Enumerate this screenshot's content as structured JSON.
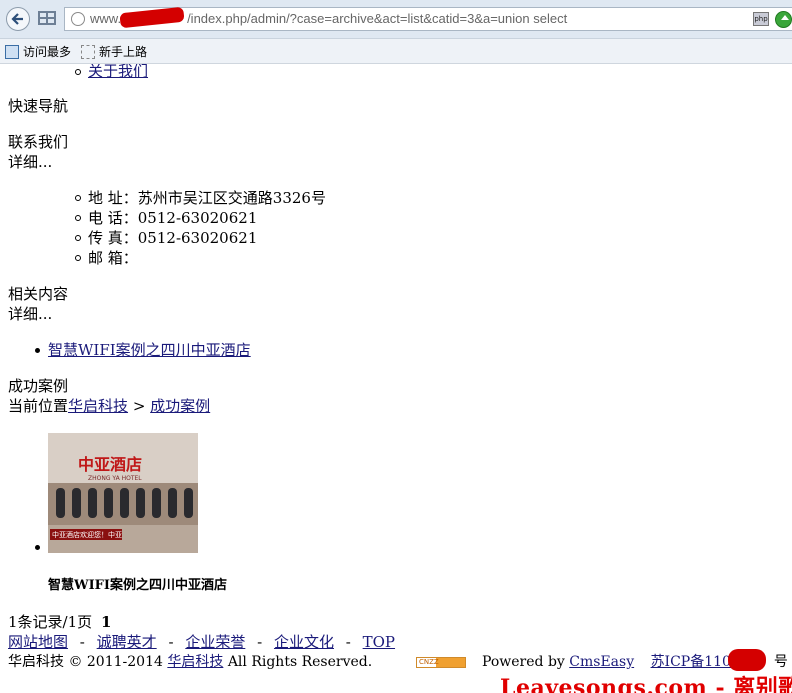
{
  "browser": {
    "url": "www.██████/index.php/admin/?case=archive&act=list&catid=3&a=union select",
    "url_visible_prefix": "www.",
    "url_visible_rest": "/index.php/admin/?case=archive&act=list&catid=3&a=union select",
    "php_badge": "php",
    "bookmarks": [
      "访问最多",
      "新手上路"
    ]
  },
  "page": {
    "top_item": "关于我们",
    "quick_nav": "快速导航",
    "contact": {
      "title": "联系我们",
      "more": "详细...",
      "items": [
        "地 址：苏州市吴江区交通路3326号",
        "电 话：0512-63020621",
        "传 真：0512-63020621",
        "邮 箱："
      ]
    },
    "related": {
      "title": "相关内容",
      "more": "详细...",
      "items": [
        "智慧WIFI案例之四川中亚酒店"
      ]
    },
    "cases": {
      "title": "成功案例",
      "breadcrumb_prefix": "当前位置",
      "breadcrumb_home": "华启科技",
      "breadcrumb_sep": ">",
      "breadcrumb_current": "成功案例",
      "thumb_sign": "中亚酒店",
      "thumb_sub": "ZHONG YA HOTEL",
      "thumb_banner": "中亚酒店欢迎您！中亚",
      "caption": "智慧WIFI案例之四川中亚酒店"
    },
    "pager": {
      "text": "1条记录/1页",
      "current": "1"
    },
    "footer": {
      "links": [
        "网站地图",
        "诚聘英才",
        "企业荣誉",
        "企业文化",
        "TOP"
      ],
      "sep": "-",
      "company": "华启科技",
      "copyright_pre": "© 2011-2014",
      "copyright_link": "华启科技",
      "rights": "All Rights Reserved.",
      "cnzz": "CNZZ",
      "powered_by": "Powered by",
      "cms": "CmsEasy",
      "icp": "苏ICP备1103",
      "icp_suffix": "号"
    },
    "watermark": "Leavesongs.com - 离别歌"
  },
  "colors": {
    "link": "#1a1a7a",
    "watermark": "#e00000"
  }
}
